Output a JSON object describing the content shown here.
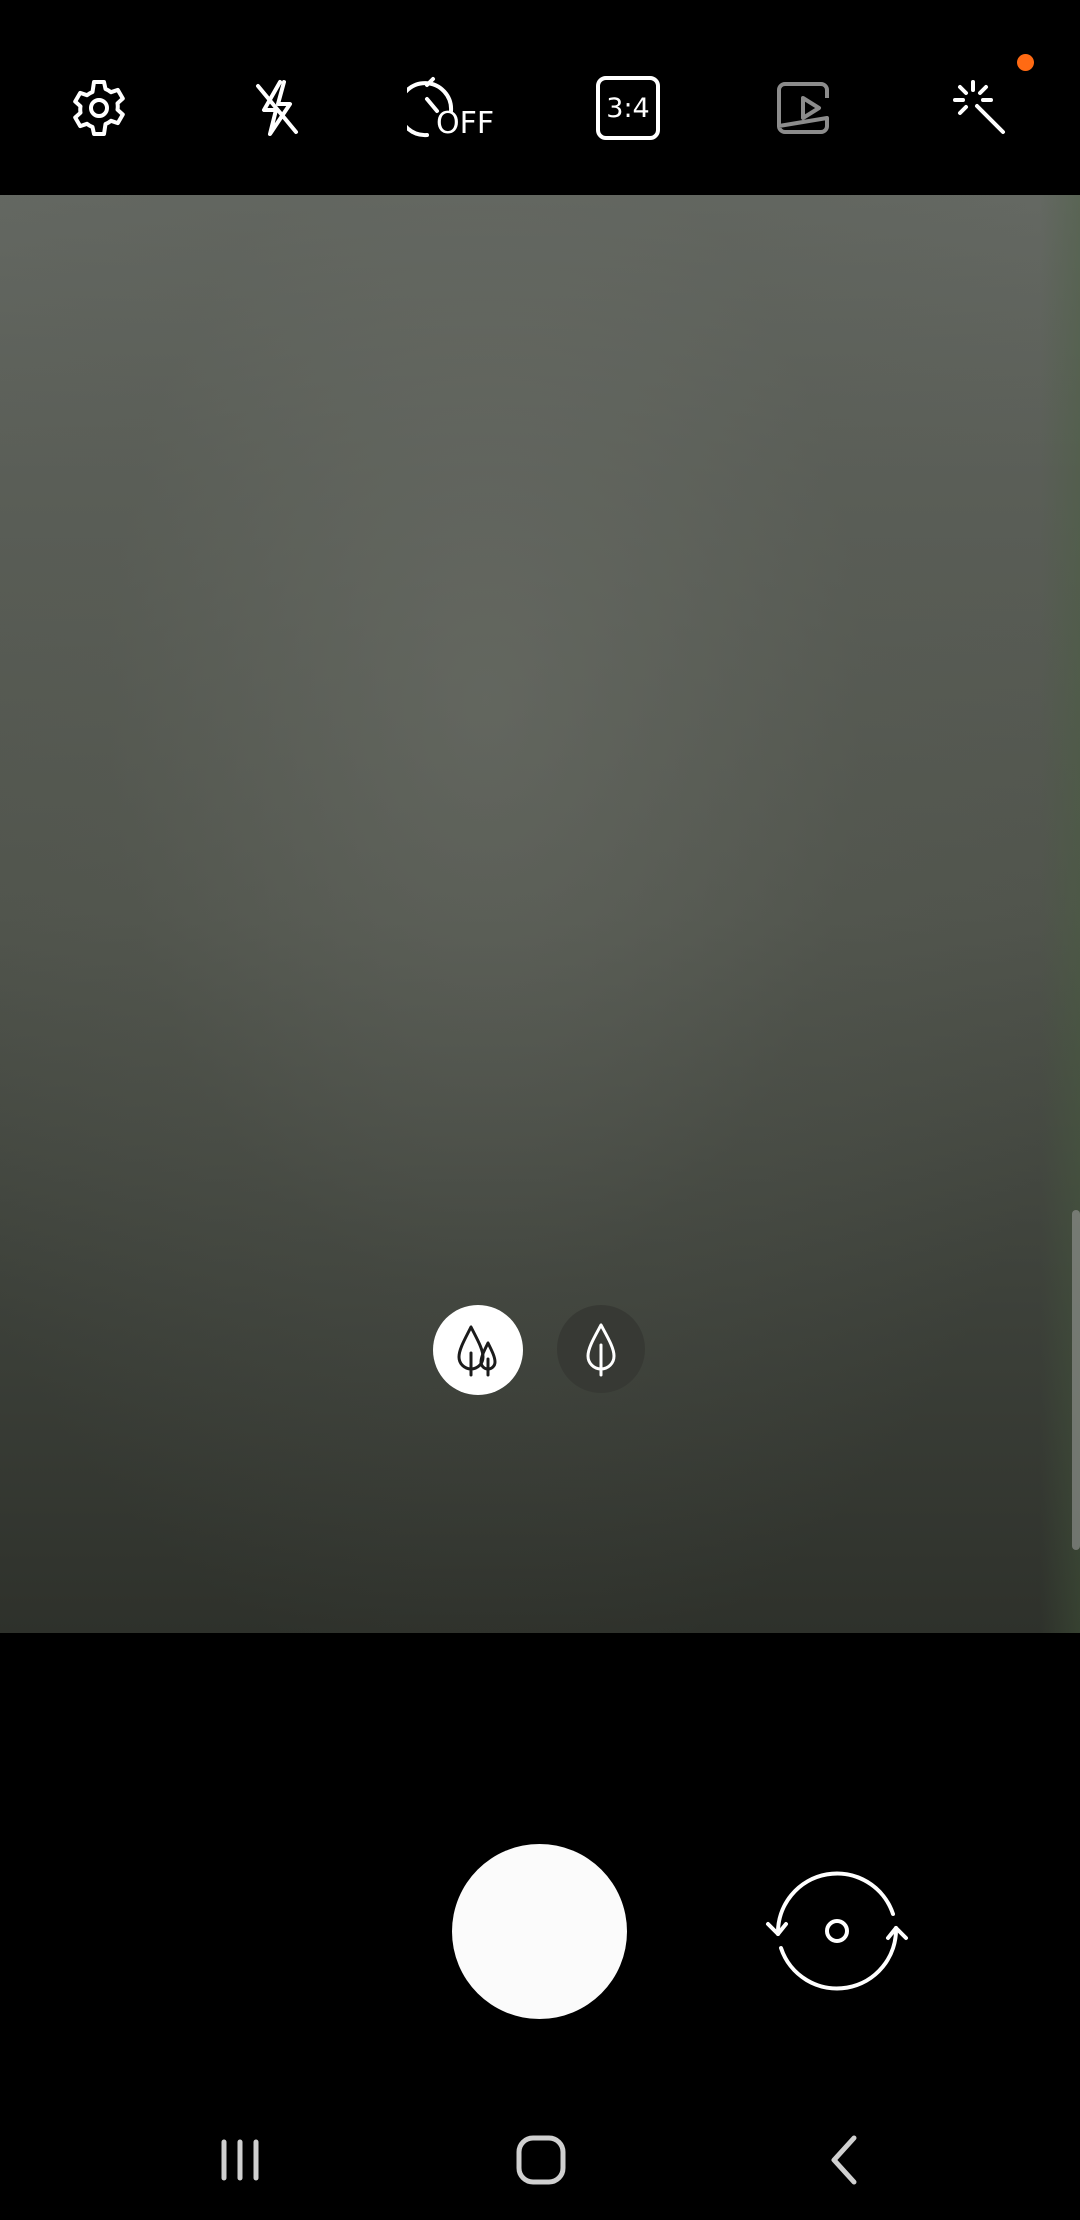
{
  "top_bar": {
    "items": [
      {
        "name": "settings",
        "icon": "gear-icon"
      },
      {
        "name": "flash",
        "icon": "flash-off-icon"
      },
      {
        "name": "timer",
        "icon": "timer-off-icon",
        "label": "OFF"
      },
      {
        "name": "ratio",
        "icon": "aspect-ratio-icon",
        "label": "3:4"
      },
      {
        "name": "motion-photo",
        "icon": "motion-photo-icon"
      },
      {
        "name": "filters",
        "icon": "magic-wand-icon"
      }
    ],
    "notification_color": "#ff6a13"
  },
  "viewfinder": {
    "lenses": [
      {
        "name": "wide",
        "icon": "trees-icon",
        "selected": true
      },
      {
        "name": "normal",
        "icon": "tree-icon",
        "selected": false
      }
    ]
  },
  "controls": {
    "shutter": "shutter-button",
    "switch_camera": "switch-camera-icon"
  },
  "nav_bar": {
    "recent": "recent-apps-icon",
    "home": "home-icon",
    "back": "back-icon"
  }
}
